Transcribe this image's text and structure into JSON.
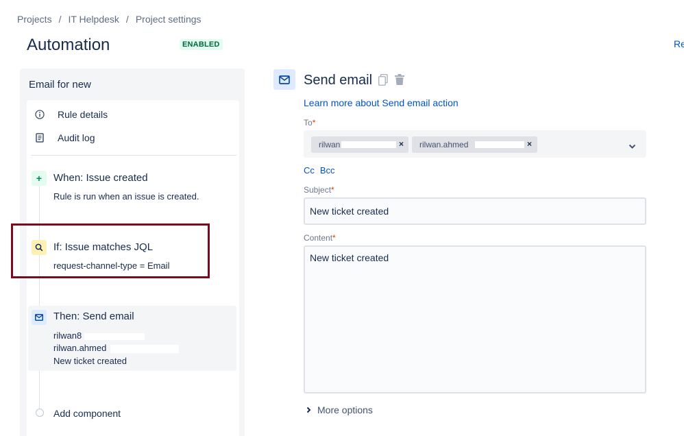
{
  "breadcrumb": {
    "items": [
      "Projects",
      "IT Helpdesk",
      "Project settings"
    ],
    "separator": "/"
  },
  "header": {
    "title": "Automation",
    "status_badge": "ENABLED",
    "right_link": "Re"
  },
  "sidebar": {
    "rule_name": "Email for new",
    "nav": [
      {
        "label": "Rule details",
        "icon": "info-icon"
      },
      {
        "label": "Audit log",
        "icon": "document-icon"
      }
    ],
    "components": {
      "trigger": {
        "title": "When: Issue created",
        "desc": "Rule is run when an issue is created.",
        "icon": "plus-icon",
        "color": "#e3fcef"
      },
      "condition": {
        "title": "If: Issue matches JQL",
        "desc": "request-channel-type = Email",
        "icon": "search-icon",
        "color": "#fff0b3"
      },
      "action": {
        "title": "Then: Send email",
        "lines": [
          "rilwan8",
          "rilwan.ahmed",
          "New ticket created"
        ],
        "icon": "mail-icon",
        "color": "#deebff"
      }
    },
    "add_component": "Add component"
  },
  "action_panel": {
    "title": "Send email",
    "learn_more": "Learn more about Send email action",
    "to": {
      "label": "To",
      "recipients": [
        "rilwan",
        "rilwan.ahmed"
      ]
    },
    "cc": "Cc",
    "bcc": "Bcc",
    "subject": {
      "label": "Subject",
      "value": "New ticket created"
    },
    "content": {
      "label": "Content",
      "value": "New ticket created"
    },
    "more_options": "More options",
    "required_marker": "*"
  },
  "colors": {
    "link": "#0052cc",
    "highlight_border": "#7a0a1e",
    "enabled_bg": "#e3fcef",
    "enabled_text": "#006644"
  }
}
